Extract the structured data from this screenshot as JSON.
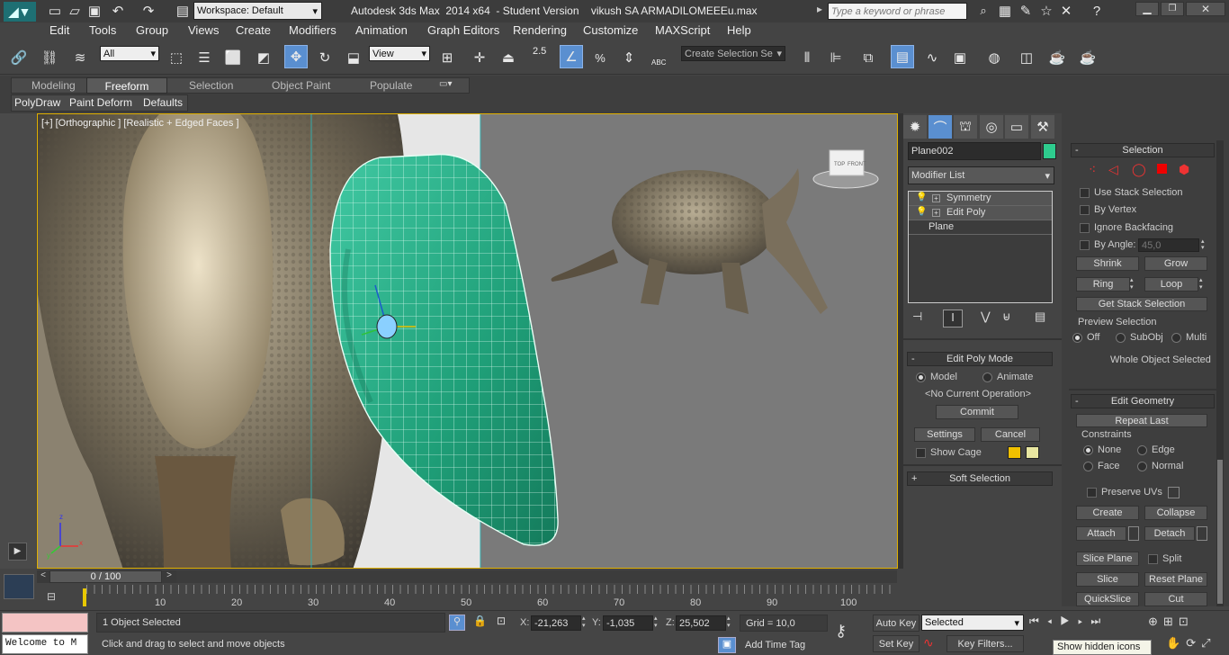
{
  "title_bar": {
    "workspace": "Workspace: Default",
    "title": "Autodesk 3ds Max  2014 x64  - Student Version    vikush SA ARMADILOMEEEu.max",
    "search_placeholder": "Type a keyword or phrase"
  },
  "menu": [
    "Edit",
    "Tools",
    "Group",
    "Views",
    "Create",
    "Modifiers",
    "Animation",
    "Graph Editors",
    "Rendering",
    "Customize",
    "MAXScript",
    "Help"
  ],
  "main_toolbar": {
    "filter": "All",
    "ref_coord": "View",
    "selection_set": "Create Selection Se",
    "snap_label": "2.5",
    "abc": "ABC"
  },
  "ribbon": {
    "tabs": [
      "Modeling",
      "Freeform",
      "Selection",
      "Object Paint",
      "Populate"
    ],
    "active_tab": "Freeform",
    "sub_tabs": [
      "PolyDraw",
      "Paint Deform",
      "Defaults"
    ]
  },
  "viewport": {
    "label": "[+] [Orthographic ] [Realistic + Edged Faces ]",
    "gizmo_top": "TOP",
    "gizmo_front": "FRONT",
    "axis_x": "x",
    "axis_y": "y",
    "axis_z": "z"
  },
  "modify_panel": {
    "object_name": "Plane002",
    "object_color": "#2ecc8e",
    "modifier_list": "Modifier List",
    "stack": [
      "Symmetry",
      "Edit Poly",
      "Plane"
    ],
    "edit_poly_mode": {
      "title": "Edit Poly Mode",
      "model": "Model",
      "animate": "Animate",
      "operation": "<No Current Operation>",
      "commit": "Commit",
      "settings": "Settings",
      "cancel": "Cancel",
      "show_cage": "Show Cage"
    },
    "soft_selection": "Soft Selection"
  },
  "selection_panel": {
    "title": "Selection",
    "use_stack": "Use Stack Selection",
    "by_vertex": "By Vertex",
    "ignore_backfacing": "Ignore Backfacing",
    "by_angle": "By Angle:",
    "angle_value": "45,0",
    "shrink": "Shrink",
    "grow": "Grow",
    "ring": "Ring",
    "loop": "Loop",
    "get_stack": "Get Stack Selection",
    "preview": "Preview Selection",
    "off": "Off",
    "subobj": "SubObj",
    "multi": "Multi",
    "whole": "Whole Object Selected"
  },
  "edit_geometry": {
    "title": "Edit Geometry",
    "repeat_last": "Repeat Last",
    "constraints": "Constraints",
    "none": "None",
    "edge": "Edge",
    "face": "Face",
    "normal": "Normal",
    "preserve_uvs": "Preserve UVs",
    "create": "Create",
    "collapse": "Collapse",
    "attach": "Attach",
    "detach": "Detach",
    "slice_plane": "Slice Plane",
    "split": "Split",
    "slice": "Slice",
    "reset_plane": "Reset Plane",
    "quickslice": "QuickSlice",
    "cut": "Cut"
  },
  "timeline": {
    "frame": "0 / 100",
    "ticks": [
      "10",
      "20",
      "30",
      "40",
      "50",
      "60",
      "70",
      "80",
      "90",
      "100"
    ]
  },
  "status": {
    "maxscript": "Welcome to M",
    "selected": "1 Object Selected",
    "prompt": "Click and drag to select and move objects",
    "x_label": "X:",
    "x": "-21,263",
    "y_label": "Y:",
    "y": "-1,035",
    "z_label": "Z:",
    "z": "25,502",
    "grid": "Grid = 10,0",
    "auto_key": "Auto Key",
    "set_key": "Set Key",
    "key_mode": "Selected",
    "key_filters": "Key Filters...",
    "add_time_tag": "Add Time Tag",
    "tooltip": "Show hidden icons"
  }
}
